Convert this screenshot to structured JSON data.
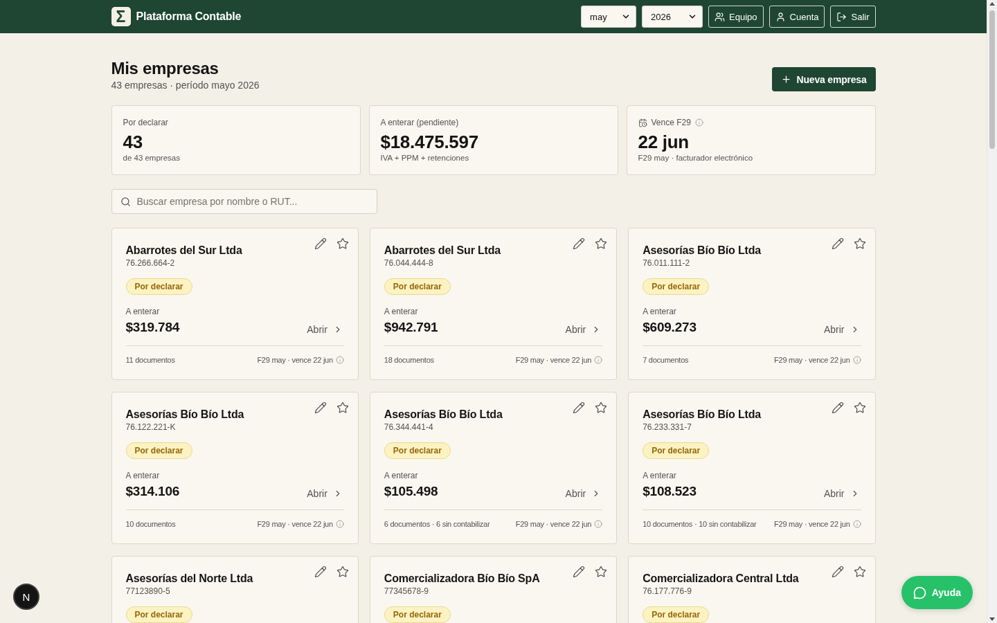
{
  "header": {
    "logo_mark": "Σ",
    "title": "Plataforma Contable",
    "month_select": "may",
    "year_select": "2026",
    "buttons": [
      {
        "label": "Equipo",
        "kind": "team"
      },
      {
        "label": "Cuenta",
        "kind": "account"
      },
      {
        "label": "Salir",
        "kind": "logout"
      }
    ]
  },
  "page": {
    "title": "Mis empresas",
    "subtitle": "43 empresas · período mayo 2026",
    "new_button": "Nueva empresa"
  },
  "stats": [
    {
      "kind": "count",
      "label": "Por declarar",
      "value": "43",
      "note": "de 43 empresas"
    },
    {
      "kind": "amount",
      "label": "A enterar (pendiente)",
      "value": "$18.475.597",
      "note": "IVA + PPM + retenciones"
    },
    {
      "kind": "deadline",
      "label": "Vence F29",
      "value": "22 jun",
      "note": "F29 may · facturador electrónico"
    }
  ],
  "search": {
    "placeholder": "Buscar empresa por nombre o RUT..."
  },
  "companies": [
    {
      "name": "Abarrotes del Sur Ltda",
      "rut": "76.266.664-2",
      "starred": false,
      "status": "Por declarar",
      "amount_label": "A enterar",
      "amount": "$319.784",
      "open_label": "Abrir",
      "documents": "11 documentos",
      "due": "F29 may · vence 22 jun"
    },
    {
      "name": "Abarrotes del Sur Ltda",
      "rut": "76.044.444-8",
      "starred": false,
      "status": "Por declarar",
      "amount_label": "A enterar",
      "amount": "$942.791",
      "open_label": "Abrir",
      "documents": "18 documentos",
      "due": "F29 may · vence 22 jun"
    },
    {
      "name": "Asesorías Bío Bío Ltda",
      "rut": "76.011.111-2",
      "starred": false,
      "status": "Por declarar",
      "amount_label": "A enterar",
      "amount": "$609.273",
      "open_label": "Abrir",
      "documents": "7 documentos",
      "due": "F29 may · vence 22 jun"
    },
    {
      "name": "Asesorías Bío Bío Ltda",
      "rut": "76.122.221-K",
      "starred": false,
      "status": "Por declarar",
      "amount_label": "A enterar",
      "amount": "$314.106",
      "open_label": "Abrir",
      "documents": "10 documentos",
      "due": "F29 may · vence 22 jun"
    },
    {
      "name": "Asesorías Bío Bío Ltda",
      "rut": "76.344.441-4",
      "starred": false,
      "status": "Por declarar",
      "amount_label": "A enterar",
      "amount": "$105.498",
      "open_label": "Abrir",
      "documents": "6 documentos · 6 sin contabilizar",
      "due": "F29 may · vence 22 jun"
    },
    {
      "name": "Asesorías Bío Bío Ltda",
      "rut": "76.233.331-7",
      "starred": false,
      "status": "Por declarar",
      "amount_label": "A enterar",
      "amount": "$108.523",
      "open_label": "Abrir",
      "documents": "10 documentos · 10 sin contabilizar",
      "due": "F29 may · vence 22 jun"
    },
    {
      "name": "Asesorías del Norte Ltda",
      "rut": "77123890-5",
      "starred": false,
      "status": "Por declarar"
    },
    {
      "name": "Comercializadora Bío Bío SpA",
      "rut": "77345678-9",
      "starred": false,
      "status": "Por declarar"
    },
    {
      "name": "Comercializadora Central Ltda",
      "rut": "76.177.776-9",
      "starred": false,
      "status": "Por declarar"
    }
  ],
  "help_button": {
    "label": "Ayuda"
  },
  "dev_indicator": {
    "label": "N"
  }
}
